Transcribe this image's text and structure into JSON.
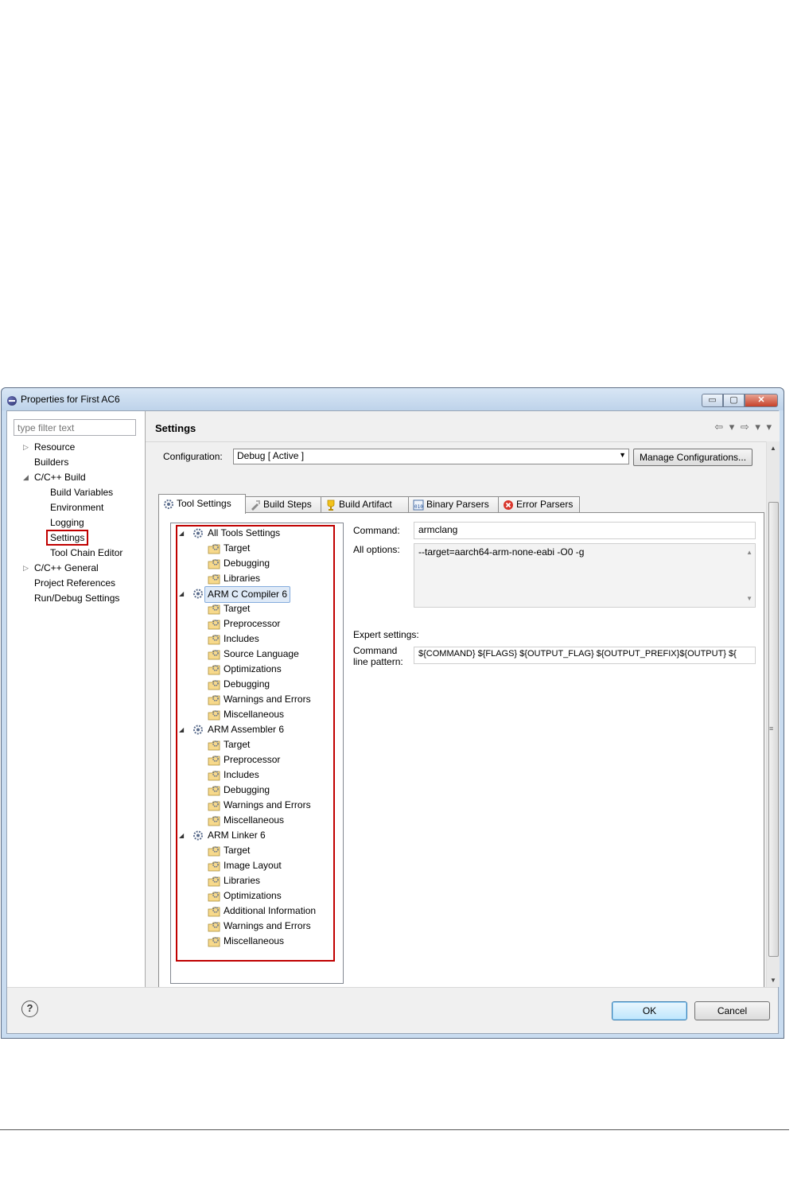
{
  "window": {
    "title": "Properties for First AC6",
    "minimize_glyph": "▭",
    "maximize_glyph": "▢",
    "close_glyph": "✕"
  },
  "nav": {
    "filter_placeholder": "type filter text",
    "items": [
      {
        "label": "Resource"
      },
      {
        "label": "Builders"
      },
      {
        "label": "C/C++ Build"
      },
      {
        "label": "Build Variables"
      },
      {
        "label": "Environment"
      },
      {
        "label": "Logging"
      },
      {
        "label": "Settings"
      },
      {
        "label": "Tool Chain Editor"
      },
      {
        "label": "C/C++ General"
      },
      {
        "label": "Project References"
      },
      {
        "label": "Run/Debug Settings"
      }
    ]
  },
  "page": {
    "title": "Settings",
    "nav_arrows": "⇦ ▾ ⇨ ▾ ▾",
    "configuration_label": "Configuration:",
    "configuration_value": "Debug  [ Active ]",
    "manage_button": "Manage Configurations..."
  },
  "tabs": [
    {
      "label": "Tool Settings",
      "icon": "gear-icon"
    },
    {
      "label": "Build Steps",
      "icon": "build-steps-icon"
    },
    {
      "label": "Build Artifact",
      "icon": "trophy-icon"
    },
    {
      "label": "Binary Parsers",
      "icon": "binary-icon"
    },
    {
      "label": "Error Parsers",
      "icon": "error-icon"
    }
  ],
  "tree": [
    {
      "label": "All Tools Settings",
      "level": 0
    },
    {
      "label": "Target",
      "level": 1
    },
    {
      "label": "Debugging",
      "level": 1
    },
    {
      "label": "Libraries",
      "level": 1
    },
    {
      "label": "ARM C Compiler 6",
      "level": 0,
      "selected": true
    },
    {
      "label": "Target",
      "level": 1
    },
    {
      "label": "Preprocessor",
      "level": 1
    },
    {
      "label": "Includes",
      "level": 1
    },
    {
      "label": "Source Language",
      "level": 1
    },
    {
      "label": "Optimizations",
      "level": 1
    },
    {
      "label": "Debugging",
      "level": 1
    },
    {
      "label": "Warnings and Errors",
      "level": 1
    },
    {
      "label": "Miscellaneous",
      "level": 1
    },
    {
      "label": "ARM Assembler 6",
      "level": 0
    },
    {
      "label": "Target",
      "level": 1
    },
    {
      "label": "Preprocessor",
      "level": 1
    },
    {
      "label": "Includes",
      "level": 1
    },
    {
      "label": "Debugging",
      "level": 1
    },
    {
      "label": "Warnings and Errors",
      "level": 1
    },
    {
      "label": "Miscellaneous",
      "level": 1
    },
    {
      "label": "ARM Linker 6",
      "level": 0
    },
    {
      "label": "Target",
      "level": 1
    },
    {
      "label": "Image Layout",
      "level": 1
    },
    {
      "label": "Libraries",
      "level": 1
    },
    {
      "label": "Optimizations",
      "level": 1
    },
    {
      "label": "Additional Information",
      "level": 1
    },
    {
      "label": "Warnings and Errors",
      "level": 1
    },
    {
      "label": "Miscellaneous",
      "level": 1
    }
  ],
  "options": {
    "command_label": "Command:",
    "command_value": "armclang",
    "all_options_label": "All options:",
    "all_options_value": "--target=aarch64-arm-none-eabi -O0 -g",
    "expert_label": "Expert settings:",
    "pattern_label_1": "Command",
    "pattern_label_2": "line pattern:",
    "pattern_value": "${COMMAND} ${FLAGS} ${OUTPUT_FLAG} ${OUTPUT_PREFIX}${OUTPUT} ${"
  },
  "footer": {
    "help_glyph": "?",
    "ok": "OK",
    "cancel": "Cancel"
  },
  "colors": {
    "highlight_red": "#c00000",
    "selection_blue": "#84acdd"
  }
}
